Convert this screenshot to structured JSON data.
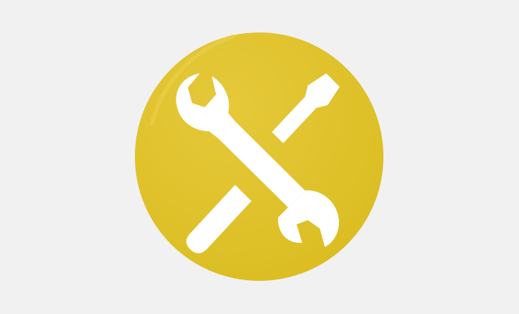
{
  "icon": {
    "name": "wrench-screwdriver-icon",
    "badge_color": "#dbbd22",
    "badge_highlight": "#e6c93a",
    "glyph_color": "#ffffff",
    "background": "#f1f1f1"
  }
}
